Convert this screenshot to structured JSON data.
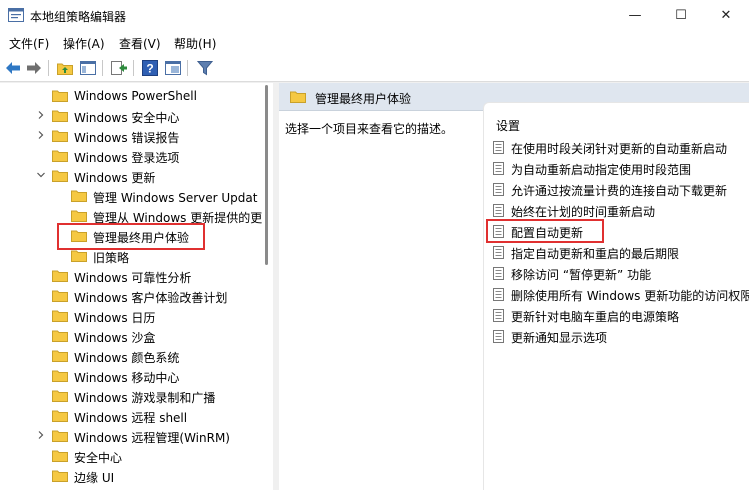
{
  "window": {
    "title": "本地组策略编辑器",
    "minimize_glyph": "—",
    "maximize_glyph": "☐",
    "close_glyph": "✕"
  },
  "menu": [
    "文件(F)",
    "操作(A)",
    "查看(V)",
    "帮助(H)"
  ],
  "toolbar_icons": [
    "back-arrow-icon",
    "forward-arrow-icon",
    "up-folder-icon",
    "show-hide-tree-icon",
    "export-list-icon",
    "help-icon",
    "properties-view-icon",
    "filter-icon"
  ],
  "tree": {
    "items": [
      {
        "label": "Windows PowerShell",
        "expander": "none",
        "level": 1
      },
      {
        "label": "Windows 安全中心",
        "expander": "collapsed",
        "level": 1
      },
      {
        "label": "Windows 错误报告",
        "expander": "collapsed",
        "level": 1
      },
      {
        "label": "Windows 登录选项",
        "expander": "none",
        "level": 1
      },
      {
        "label": "Windows 更新",
        "expander": "expanded",
        "level": 1
      },
      {
        "label": "管理 Windows Server Updat",
        "expander": "none",
        "level": 2
      },
      {
        "label": "管理从 Windows 更新提供的更",
        "expander": "none",
        "level": 2
      },
      {
        "label": "管理最终用户体验",
        "expander": "none",
        "level": 2,
        "selected": true
      },
      {
        "label": "旧策略",
        "expander": "none",
        "level": 2
      },
      {
        "label": "Windows 可靠性分析",
        "expander": "none",
        "level": 1
      },
      {
        "label": "Windows 客户体验改善计划",
        "expander": "none",
        "level": 1
      },
      {
        "label": "Windows 日历",
        "expander": "none",
        "level": 1
      },
      {
        "label": "Windows 沙盒",
        "expander": "none",
        "level": 1
      },
      {
        "label": "Windows 颜色系统",
        "expander": "none",
        "level": 1
      },
      {
        "label": "Windows 移动中心",
        "expander": "none",
        "level": 1
      },
      {
        "label": "Windows 游戏录制和广播",
        "expander": "none",
        "level": 1
      },
      {
        "label": "Windows 远程 shell",
        "expander": "none",
        "level": 1
      },
      {
        "label": "Windows 远程管理(WinRM)",
        "expander": "collapsed",
        "level": 1
      },
      {
        "label": "安全中心",
        "expander": "none",
        "level": 1
      },
      {
        "label": "边缘 UI",
        "expander": "none",
        "level": 1
      }
    ]
  },
  "details": {
    "header_title": "管理最终用户体验",
    "description": "选择一个项目来查看它的描述。",
    "settings_header": "设置",
    "settings": [
      "在使用时段关闭针对更新的自动重新启动",
      "为自动重新启动指定使用时段范围",
      "允许通过按流量计费的连接自动下载更新",
      "始终在计划的时间重新启动",
      "配置自动更新",
      "指定自动更新和重启的最后期限",
      "移除访问 “暂停更新” 功能",
      "删除使用所有 Windows 更新功能的访问权限",
      "更新针对电脑车重启的电源策略",
      "更新通知显示选项"
    ],
    "highlighted_setting": "配置自动更新"
  },
  "colors": {
    "folder": "#f5c842",
    "highlight_border": "#e03030",
    "header_bg": "#dfe6ef"
  }
}
